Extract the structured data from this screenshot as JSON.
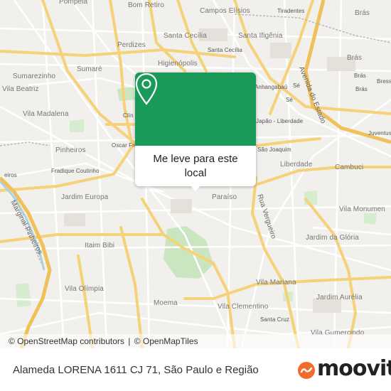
{
  "map": {
    "labels": {
      "pompeia": "Pompéia",
      "campos_eliseos": "Campos Elísios",
      "bom_retiro": "Bom Retiro",
      "tiradentes": "Tiradentes",
      "bras_top": "Brás",
      "santa_cecilia": "Santa Cecília",
      "santa_ifigenia": "Santa Ifigênia",
      "perdizes": "Perdizes",
      "santa_cecilia_station": "Santa Cecília",
      "bras": "Brás",
      "bras2": "Brás",
      "bress": "Bress",
      "sumare": "Sumaré",
      "higienopolis": "Higienópolis",
      "sumarezinho": "Sumarezinho",
      "vila_beatriz": "Vila Beatriz",
      "anhangabau": "Anhangabaú",
      "se": "Sé",
      "se2": "Sé",
      "avenida_estado": "Avenida do Estado",
      "vila_madalena": "Vila Madalena",
      "clinicas": "Clín",
      "liberdade_station": "Japão - Liberdade",
      "juventus": "Juventus",
      "oscar_freire": "Oscar Fre",
      "pinheiros": "Pinheiros",
      "sao_joaquim": "São Joaquim",
      "liberdade": "Liberdade",
      "cambuci": "Cambuci",
      "fradique": "Fradique Coutinho",
      "eiros": "eiros",
      "jardim_europa": "Jardim Europa",
      "paraiso": "Paraíso",
      "rua_vergueiro": "Rua Vergueiro",
      "vila_monumento": "Vila Monumen",
      "marginal": "Marginal Pinheiros",
      "jardim_gloria": "Jardim da Glória",
      "itaim_bibi": "Itaim Bibi",
      "vila_mariana": "Vila Mariana",
      "vila_olimpia": "Vila Olímpia",
      "moema": "Moema",
      "vila_clementino": "Vila Clementino",
      "jardim_aurelia": "Jardim Aurélia",
      "santa_cruz": "Santa Cruz",
      "vila_gumercindo": "Vila Gumercindo"
    },
    "popup": {
      "text": "Me leve para este local",
      "pin_icon": "location-pin-icon"
    },
    "attribution": {
      "osm": "© OpenStreetMap contributors",
      "omt": "© OpenMapTiles"
    }
  },
  "footer": {
    "title": "Alameda LORENA 1611 CJ 71, São Paulo e Região",
    "logo_text": "moovit",
    "logo_icon": "moovit-logo-icon"
  },
  "colors": {
    "popup_green": "#199a58",
    "map_bg": "#f2f0ec",
    "major_road": "#f7d783",
    "park": "#c9e6c1",
    "logo_orange": "#f26b2a"
  }
}
